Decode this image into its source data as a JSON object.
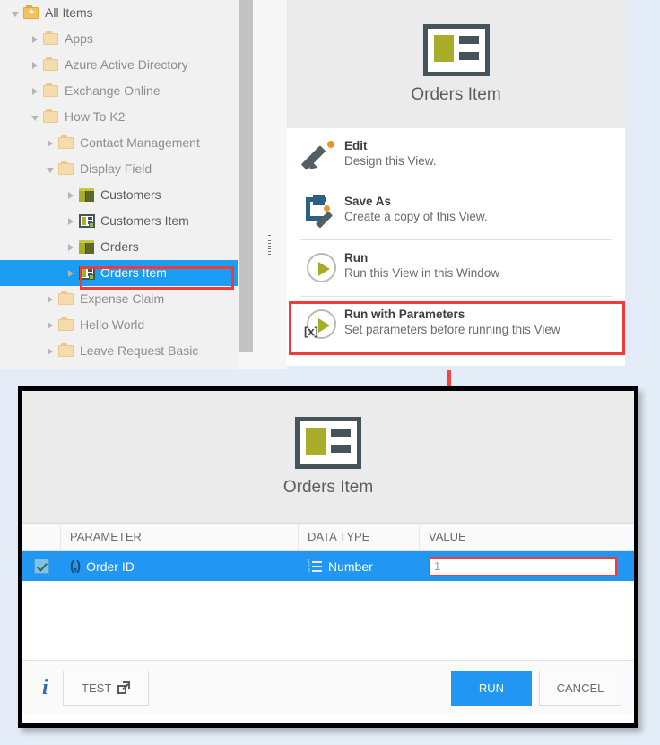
{
  "tree": {
    "items": [
      {
        "label": "All Items",
        "icon": "folder-star-icon",
        "indent": 0,
        "expander": "down",
        "style": "dark",
        "selected": false
      },
      {
        "label": "Apps",
        "icon": "folder-icon",
        "indent": 1,
        "expander": "right",
        "style": "muted",
        "selected": false
      },
      {
        "label": "Azure Active Directory",
        "icon": "folder-icon",
        "indent": 1,
        "expander": "right",
        "style": "muted",
        "selected": false
      },
      {
        "label": "Exchange Online",
        "icon": "folder-icon",
        "indent": 1,
        "expander": "right",
        "style": "muted",
        "selected": false
      },
      {
        "label": "How To K2",
        "icon": "folder-icon",
        "indent": 1,
        "expander": "down",
        "style": "muted",
        "selected": false
      },
      {
        "label": "Contact Management",
        "icon": "folder-icon",
        "indent": 2,
        "expander": "right",
        "style": "muted",
        "selected": false
      },
      {
        "label": "Display Field",
        "icon": "folder-icon",
        "indent": 2,
        "expander": "down",
        "style": "muted",
        "selected": false
      },
      {
        "label": "Customers",
        "icon": "smartobject-icon",
        "indent": 3,
        "expander": "right",
        "style": "dark",
        "selected": false
      },
      {
        "label": "Customers Item",
        "icon": "view-icon",
        "indent": 3,
        "expander": "right",
        "style": "dark",
        "selected": false
      },
      {
        "label": "Orders",
        "icon": "smartobject-icon",
        "indent": 3,
        "expander": "right",
        "style": "dark",
        "selected": false
      },
      {
        "label": "Orders Item",
        "icon": "view-icon",
        "indent": 3,
        "expander": "right",
        "style": "dark",
        "selected": true
      },
      {
        "label": "Expense Claim",
        "icon": "folder-icon",
        "indent": 2,
        "expander": "right",
        "style": "muted",
        "selected": false
      },
      {
        "label": "Hello World",
        "icon": "folder-icon",
        "indent": 2,
        "expander": "right",
        "style": "muted",
        "selected": false
      },
      {
        "label": "Leave Request Basic",
        "icon": "folder-icon",
        "indent": 2,
        "expander": "right",
        "style": "muted",
        "selected": false
      }
    ]
  },
  "context_panel": {
    "title": "Orders Item",
    "menu": [
      {
        "title": "Edit",
        "subtitle": "Design this View.",
        "icon": "pencil-icon"
      },
      {
        "title": "Save As",
        "subtitle": "Create a copy of this View.",
        "icon": "save-as-icon"
      },
      {
        "title": "Run",
        "subtitle": "Run this View in this Window",
        "icon": "play-icon"
      },
      {
        "title": "Run with Parameters",
        "subtitle": "Set parameters before running this View",
        "icon": "play-with-params-icon"
      }
    ]
  },
  "dialog": {
    "title": "Orders Item",
    "grid": {
      "headers": [
        "",
        "PARAMETER",
        "DATA TYPE",
        "VALUE"
      ],
      "rows": [
        {
          "checked": true,
          "parameter": "Order ID",
          "parameter_icon": "(,)",
          "data_type": "Number",
          "data_type_icon": "number-list-icon",
          "value": "1",
          "value_placeholder": ""
        }
      ]
    },
    "footer": {
      "info_label": "i",
      "test_label": "TEST",
      "run_label": "RUN",
      "cancel_label": "CANCEL"
    }
  },
  "colors": {
    "accent_blue": "#2196f3",
    "highlight_red": "#f13b3b",
    "olive": "#a9ad2a",
    "page_background": "#e4ecf7"
  }
}
